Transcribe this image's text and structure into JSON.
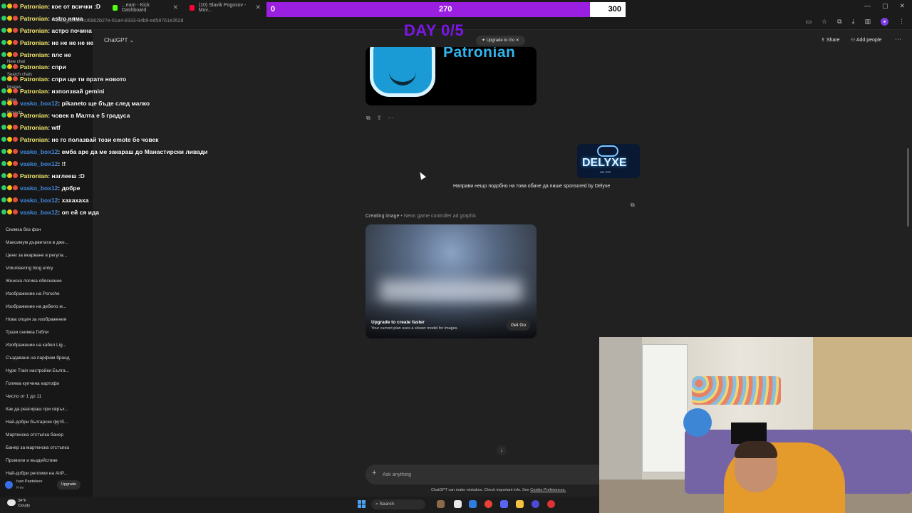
{
  "browser": {
    "tabs": [
      {
        "title": "...eam - Kick Dashboard"
      },
      {
        "title": "(10) Slavik Pogosov - Mov..."
      }
    ],
    "url": "chatgpt.com/c/6962b27e-61a4-8333-94b9-ed58761e352d"
  },
  "goal": {
    "min": "0",
    "current": "270",
    "max": "300",
    "progress": 0.9,
    "day": "DAY 0/5"
  },
  "chat": {
    "messages": [
      {
        "user": "Patronian",
        "color": "#f2e86b",
        "text": ": кое от всички :D"
      },
      {
        "user": "Patronian",
        "color": "#f2e86b",
        "text": ": astro няма"
      },
      {
        "user": "Patronian",
        "color": "#f2e86b",
        "text": ": астро почина"
      },
      {
        "user": "Patronian",
        "color": "#f2e86b",
        "text": ": не не не не не"
      },
      {
        "user": "Patronian",
        "color": "#f2e86b",
        "text": ": плс не"
      },
      {
        "user": "Patronian",
        "color": "#f2e86b",
        "text": ": спри"
      },
      {
        "user": "Patronian",
        "color": "#f2e86b",
        "text": ": спри ще ти пратя новото"
      },
      {
        "user": "Patronian",
        "color": "#f2e86b",
        "text": ": използвай gemini"
      },
      {
        "user": "vasko_box12",
        "color": "#3f8ae0",
        "text": ": pikaneto ще бъде след малко"
      },
      {
        "user": "Patronian",
        "color": "#f2e86b",
        "text": ": човек в Малта е 5 градуса"
      },
      {
        "user": "Patronian",
        "color": "#f2e86b",
        "text": ": wtf"
      },
      {
        "user": "Patronian",
        "color": "#f2e86b",
        "text": ": не го полазвай този emote бе човек"
      },
      {
        "user": "vasko_box12",
        "color": "#3f8ae0",
        "text": ": емба аре да ме закараш до Манастирски ливади"
      },
      {
        "user": "vasko_box12",
        "color": "#3f8ae0",
        "text": ": !!"
      },
      {
        "user": "Patronian",
        "color": "#f2e86b",
        "text": ": наглееш :D"
      },
      {
        "user": "vasko_box12",
        "color": "#3f8ae0",
        "text": ": добре"
      },
      {
        "user": "vasko_box12",
        "color": "#3f8ae0",
        "text": ": хахахаха"
      },
      {
        "user": "vasko_box12",
        "color": "#3f8ae0",
        "text": ": оп ей ся ида"
      }
    ]
  },
  "sidebar": {
    "top": [
      "New chat",
      "Search chats",
      "Images",
      "Apps",
      "Projects"
    ],
    "items": [
      "Снимка без фон",
      "Максимум дърветата в дже...",
      "Цени за вкарване в регула...",
      "Volunteering blog entry",
      "Женска логика обяснение",
      "Изображение на Porsche",
      "Изображение на дебело м...",
      "Нова опция за изображения",
      "Трази снимка Гибли",
      "Изображение на кабел Lig...",
      "Създаване на парфюм бранд",
      "Hype Train настройки Бълга...",
      "Голяма купчина картофи",
      "Число от 1 до 11",
      "Как да реагираш при свръх...",
      "Най-добри български футб...",
      "Мартенска отстъпка банер",
      "Банер за мартенска отстъпка",
      "Промили и въздействие",
      "Най-добри реплики на AirP..."
    ],
    "user": {
      "name": "Ivan Panteleev",
      "plan": "Free",
      "upgrade": "Upgrade"
    }
  },
  "header": {
    "model": "ChatGPT",
    "upgrade_go": "Upgrade to Go",
    "share": "Share",
    "add_people": "Add people"
  },
  "conversation": {
    "prev_image_word": "Patronian",
    "user_image_word": "DELYXE",
    "user_image_sub": "ON TOP",
    "user_message": "Направи нещо подобно на това обаче да пише sponsored by Delyxe",
    "creating_label": "Creating image",
    "creating_desc": "• Neon game controller ad graphic",
    "upsell_title": "Upgrade to create faster",
    "upsell_sub": "Your current plan uses a slower model for images.",
    "upsell_button": "Get Go"
  },
  "composer": {
    "placeholder": "Ask anything",
    "disclaimer": "ChatGPT can make mistakes. Check important info. See",
    "disclaimer_link": "Cookie Preferences."
  },
  "taskbar": {
    "weather_temp": "34°F",
    "weather_desc": "Cloudy",
    "search": "Search"
  },
  "colors": {
    "accent_purple": "#9a1fe0",
    "day_purple": "#7c16e8",
    "brand_blue": "#33b6ef"
  }
}
